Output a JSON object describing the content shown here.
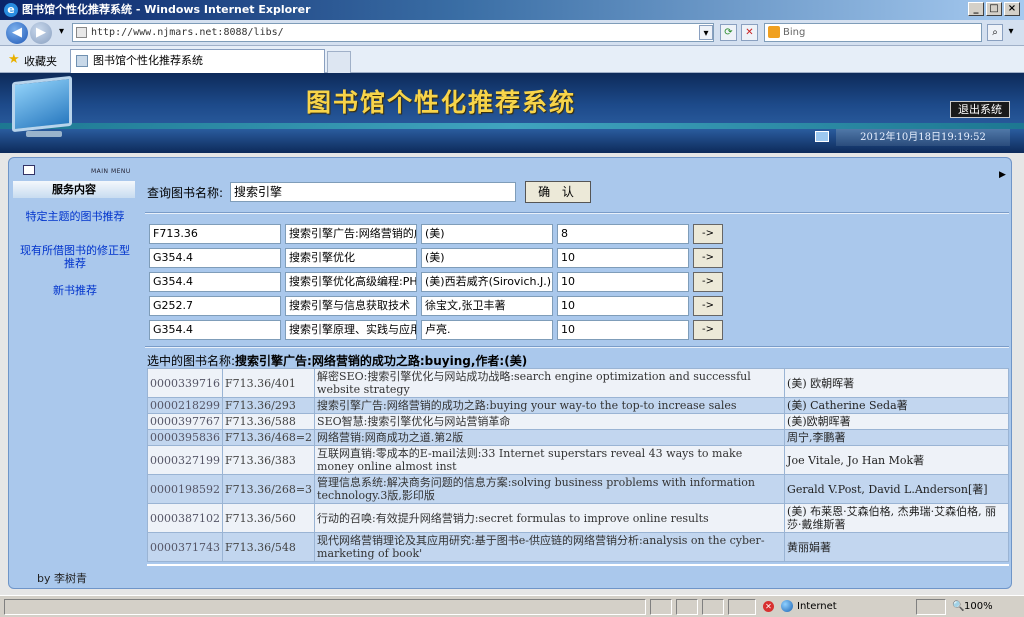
{
  "window": {
    "title": "图书馆个性化推荐系统 - Windows Internet Explorer",
    "controls": [
      "_",
      "□",
      "×"
    ]
  },
  "browser": {
    "url": "http://www.njmars.net:8088/libs/",
    "search_placeholder": "Bing",
    "favorites_label": "收藏夹",
    "tab_title": "图书馆个性化推荐系统",
    "zone": "Internet",
    "zoom": "100%"
  },
  "header": {
    "title": "图书馆个性化推荐系统",
    "logout_label": "退出系统",
    "datetime": "2012年10月18日19:19:52"
  },
  "sidebar": {
    "menu_label": "MAIN MENU",
    "section_title": "服务内容",
    "links": [
      "特定主题的图书推荐",
      "现有所借图书的修正型推荐",
      "新书推荐"
    ],
    "byline": "by 李树青"
  },
  "query": {
    "label": "查询图书名称:",
    "value": "搜索引擎",
    "confirm_label": "确 认"
  },
  "results": [
    {
      "call_no": "F713.36",
      "title": "搜索引擎广告:网络营销的成功之路",
      "author": "(美)",
      "count": "8",
      "go": "->"
    },
    {
      "call_no": "G354.4",
      "title": "搜索引擎优化",
      "author": "(美)",
      "count": "10",
      "go": "->"
    },
    {
      "call_no": "G354.4",
      "title": "搜索引擎优化高级编程:PHP版",
      "author": "(美)西若威齐(Sirovich.J.)",
      "count": "10",
      "go": "->"
    },
    {
      "call_no": "G252.7",
      "title": "搜索引擎与信息获取技术",
      "author": "徐宝文,张卫丰著",
      "count": "10",
      "go": "->"
    },
    {
      "call_no": "G354.4",
      "title": "搜索引擎原理、实践与应用",
      "author": "卢亮.",
      "count": "10",
      "go": "->"
    }
  ],
  "selected": {
    "prefix": "选中的图书名称:",
    "text": "搜索引擎广告:网络营销的成功之路:buying,作者:(美)"
  },
  "recommendations": [
    {
      "id": "0000339716",
      "call_no": "F713.36/401",
      "title": "解密SEO:搜索引擎优化与网站成功战略:search engine optimization and successful website strategy",
      "author": "(美) 欧朝晖著"
    },
    {
      "id": "0000218299",
      "call_no": "F713.36/293",
      "title": "搜索引擎广告:网络营销的成功之路:buying your way-to the top-to increase sales",
      "author": "(美) Catherine Seda著"
    },
    {
      "id": "0000397767",
      "call_no": "F713.36/588",
      "title": "SEO智慧:搜索引擎优化与网站营销革命",
      "author": "(美)欧朝晖著"
    },
    {
      "id": "0000395836",
      "call_no": "F713.36/468=2",
      "title": "网络营销:网商成功之道.第2版",
      "author": "周宁,李鹏著"
    },
    {
      "id": "0000327199",
      "call_no": "F713.36/383",
      "title": "互联网直销:零成本的E-mail法则:33 Internet superstars reveal 43 ways to make money online almost inst",
      "author": "Joe Vitale, Jo Han Mok著"
    },
    {
      "id": "0000198592",
      "call_no": "F713.36/268=3",
      "title": "管理信息系统:解决商务问题的信息方案:solving business problems with information technology.3版,影印版",
      "author": "Gerald V.Post, David L.Anderson[著]"
    },
    {
      "id": "0000387102",
      "call_no": "F713.36/560",
      "title": "行动的召唤:有效提升网络营销力:secret formulas to improve online results",
      "author": "(美) 布莱恩·艾森伯格, 杰弗瑞·艾森伯格, 丽莎·戴维斯著"
    },
    {
      "id": "0000371743",
      "call_no": "F713.36/548",
      "title": "现代网络营销理论及其应用研究:基于图书e-供应链的网络营销分析:analysis on the cyber-marketing of book'",
      "author": "黄丽娟著"
    }
  ]
}
